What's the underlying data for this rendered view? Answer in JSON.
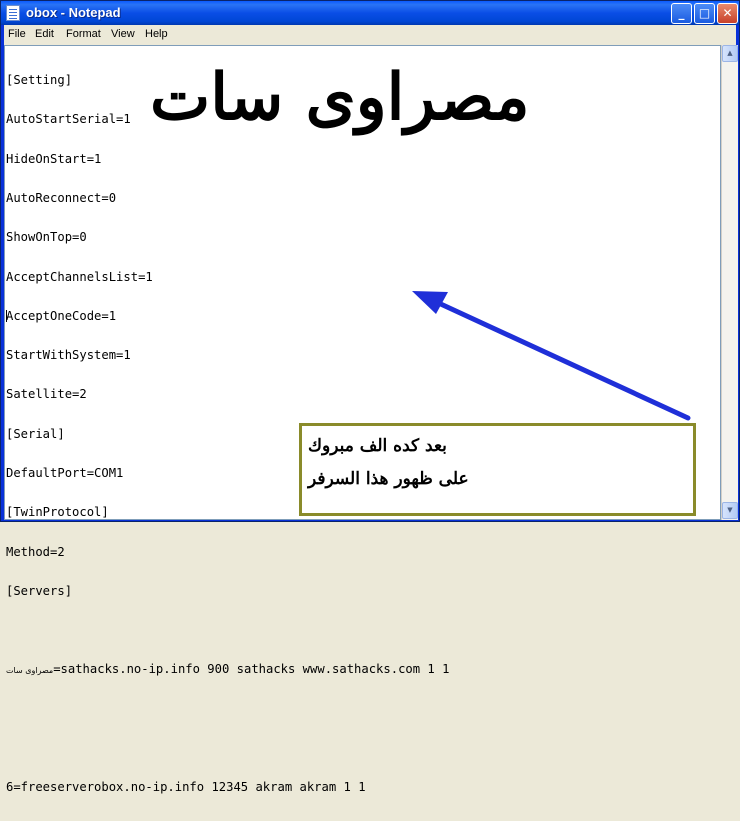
{
  "window": {
    "title": "obox - Notepad"
  },
  "titlebar_buttons": {
    "minimize": "_",
    "maximize": "□",
    "close": "✕"
  },
  "menu": [
    "File",
    "Edit",
    "Format",
    "View",
    "Help"
  ],
  "editor": {
    "lines": [
      "[Setting]",
      "AutoStartSerial=1",
      "HideOnStart=1",
      "AutoReconnect=0",
      "ShowOnTop=0",
      "AcceptChannelsList=1",
      "AcceptOneCode=1",
      "StartWithSystem=1",
      "Satellite=2",
      "[Serial]",
      "DefaultPort=COM1",
      "[TwinProtocol]",
      "Method=2",
      "[Servers]",
      "",
      "",
      "",
      "6=freeserverobox.no-ip.info 12345 akram akram 1 1"
    ],
    "server_line_prefix": "مصراوى سات",
    "server_line_rest": "=sathacks.no-ip.info 900 sathacks www.sathacks.com 1 1"
  },
  "overlay": {
    "big_title": "مصراوى سات",
    "callout_line1": "بعد كده الف مبروك",
    "callout_line2": "على ظهور هذا السرفر"
  },
  "colors": {
    "arrow": "#1f2fd8",
    "callout_border": "#8a8b2a",
    "titlebar": "#0a4ee6"
  },
  "icons": {
    "app": "notepad-icon",
    "scroll_up": "scroll-up-arrow-icon",
    "scroll_down": "scroll-down-arrow-icon"
  }
}
